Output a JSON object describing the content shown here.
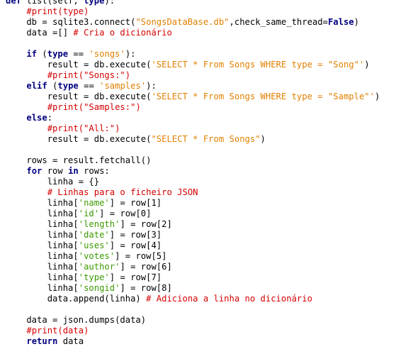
{
  "editor": {
    "language": "python",
    "colors": {
      "keyword": "#00007f",
      "string": "#e08000",
      "subscript_string": "#3c9a00",
      "comment": "#d40000",
      "text": "#000000",
      "background": "#ffffff"
    },
    "lines": [
      [
        [
          "kw",
          "def"
        ],
        [
          "pln",
          " list(self, "
        ],
        [
          "kw",
          "type"
        ],
        [
          "pln",
          "):"
        ]
      ],
      [
        [
          "pln",
          "    "
        ],
        [
          "com",
          "#print(type)"
        ]
      ],
      [
        [
          "pln",
          "    db = sqlite3.connect("
        ],
        [
          "str",
          "\"SongsDataBase.db\""
        ],
        [
          "pln",
          ",check_same_thread="
        ],
        [
          "kw",
          "False"
        ],
        [
          "pln",
          ")"
        ]
      ],
      [
        [
          "pln",
          "    data =[] "
        ],
        [
          "com",
          "# Cria o dicionário"
        ]
      ],
      [],
      [
        [
          "pln",
          "    "
        ],
        [
          "kw",
          "if"
        ],
        [
          "pln",
          " ("
        ],
        [
          "kw",
          "type"
        ],
        [
          "pln",
          " == "
        ],
        [
          "str",
          "'songs'"
        ],
        [
          "pln",
          "):"
        ]
      ],
      [
        [
          "pln",
          "        result = db.execute("
        ],
        [
          "str",
          "'SELECT * From Songs WHERE type = \"Song\"'"
        ],
        [
          "pln",
          ")"
        ]
      ],
      [
        [
          "pln",
          "        "
        ],
        [
          "com",
          "#print(\"Songs:\")"
        ]
      ],
      [
        [
          "pln",
          "    "
        ],
        [
          "kw",
          "elif"
        ],
        [
          "pln",
          " ("
        ],
        [
          "kw",
          "type"
        ],
        [
          "pln",
          " == "
        ],
        [
          "str",
          "'samples'"
        ],
        [
          "pln",
          "):"
        ]
      ],
      [
        [
          "pln",
          "        result = db.execute("
        ],
        [
          "str",
          "'SELECT * From Songs WHERE type = \"Sample\"'"
        ],
        [
          "pln",
          ")"
        ]
      ],
      [
        [
          "pln",
          "        "
        ],
        [
          "com",
          "#print(\"Samples:\")"
        ]
      ],
      [
        [
          "pln",
          "    "
        ],
        [
          "kw",
          "else"
        ],
        [
          "pln",
          ":"
        ]
      ],
      [
        [
          "pln",
          "        "
        ],
        [
          "com",
          "#print(\"All:\")"
        ]
      ],
      [
        [
          "pln",
          "        result = db.execute("
        ],
        [
          "str",
          "\"SELECT * From Songs\""
        ],
        [
          "pln",
          ")"
        ]
      ],
      [],
      [
        [
          "pln",
          "    rows = result.fetchall()"
        ]
      ],
      [
        [
          "pln",
          "    "
        ],
        [
          "kw",
          "for"
        ],
        [
          "pln",
          " row "
        ],
        [
          "kw",
          "in"
        ],
        [
          "pln",
          " rows:"
        ]
      ],
      [
        [
          "pln",
          "        linha = {}"
        ]
      ],
      [
        [
          "pln",
          "        "
        ],
        [
          "com",
          "# Linhas para o ficheiro JSON"
        ]
      ],
      [
        [
          "pln",
          "        linha["
        ],
        [
          "skey",
          "'name'"
        ],
        [
          "pln",
          "] = row[1]"
        ]
      ],
      [
        [
          "pln",
          "        linha["
        ],
        [
          "skey",
          "'id'"
        ],
        [
          "pln",
          "] = row[0]"
        ]
      ],
      [
        [
          "pln",
          "        linha["
        ],
        [
          "skey",
          "'length'"
        ],
        [
          "pln",
          "] = row[2]"
        ]
      ],
      [
        [
          "pln",
          "        linha["
        ],
        [
          "skey",
          "'date'"
        ],
        [
          "pln",
          "] = row[3]"
        ]
      ],
      [
        [
          "pln",
          "        linha["
        ],
        [
          "skey",
          "'uses'"
        ],
        [
          "pln",
          "] = row[4]"
        ]
      ],
      [
        [
          "pln",
          "        linha["
        ],
        [
          "skey",
          "'votes'"
        ],
        [
          "pln",
          "] = row[5]"
        ]
      ],
      [
        [
          "pln",
          "        linha["
        ],
        [
          "skey",
          "'author'"
        ],
        [
          "pln",
          "] = row[6]"
        ]
      ],
      [
        [
          "pln",
          "        linha["
        ],
        [
          "skey",
          "'type'"
        ],
        [
          "pln",
          "] = row[7]"
        ]
      ],
      [
        [
          "pln",
          "        linha["
        ],
        [
          "skey",
          "'songid'"
        ],
        [
          "pln",
          "] = row[8]"
        ]
      ],
      [
        [
          "pln",
          "        data.append(linha) "
        ],
        [
          "com",
          "# Adiciona a linha no dicionário"
        ]
      ],
      [],
      [
        [
          "pln",
          "    data = json.dumps(data)"
        ]
      ],
      [
        [
          "pln",
          "    "
        ],
        [
          "com",
          "#print(data)"
        ]
      ],
      [
        [
          "pln",
          "    "
        ],
        [
          "kw",
          "return"
        ],
        [
          "pln",
          " data"
        ]
      ]
    ]
  }
}
